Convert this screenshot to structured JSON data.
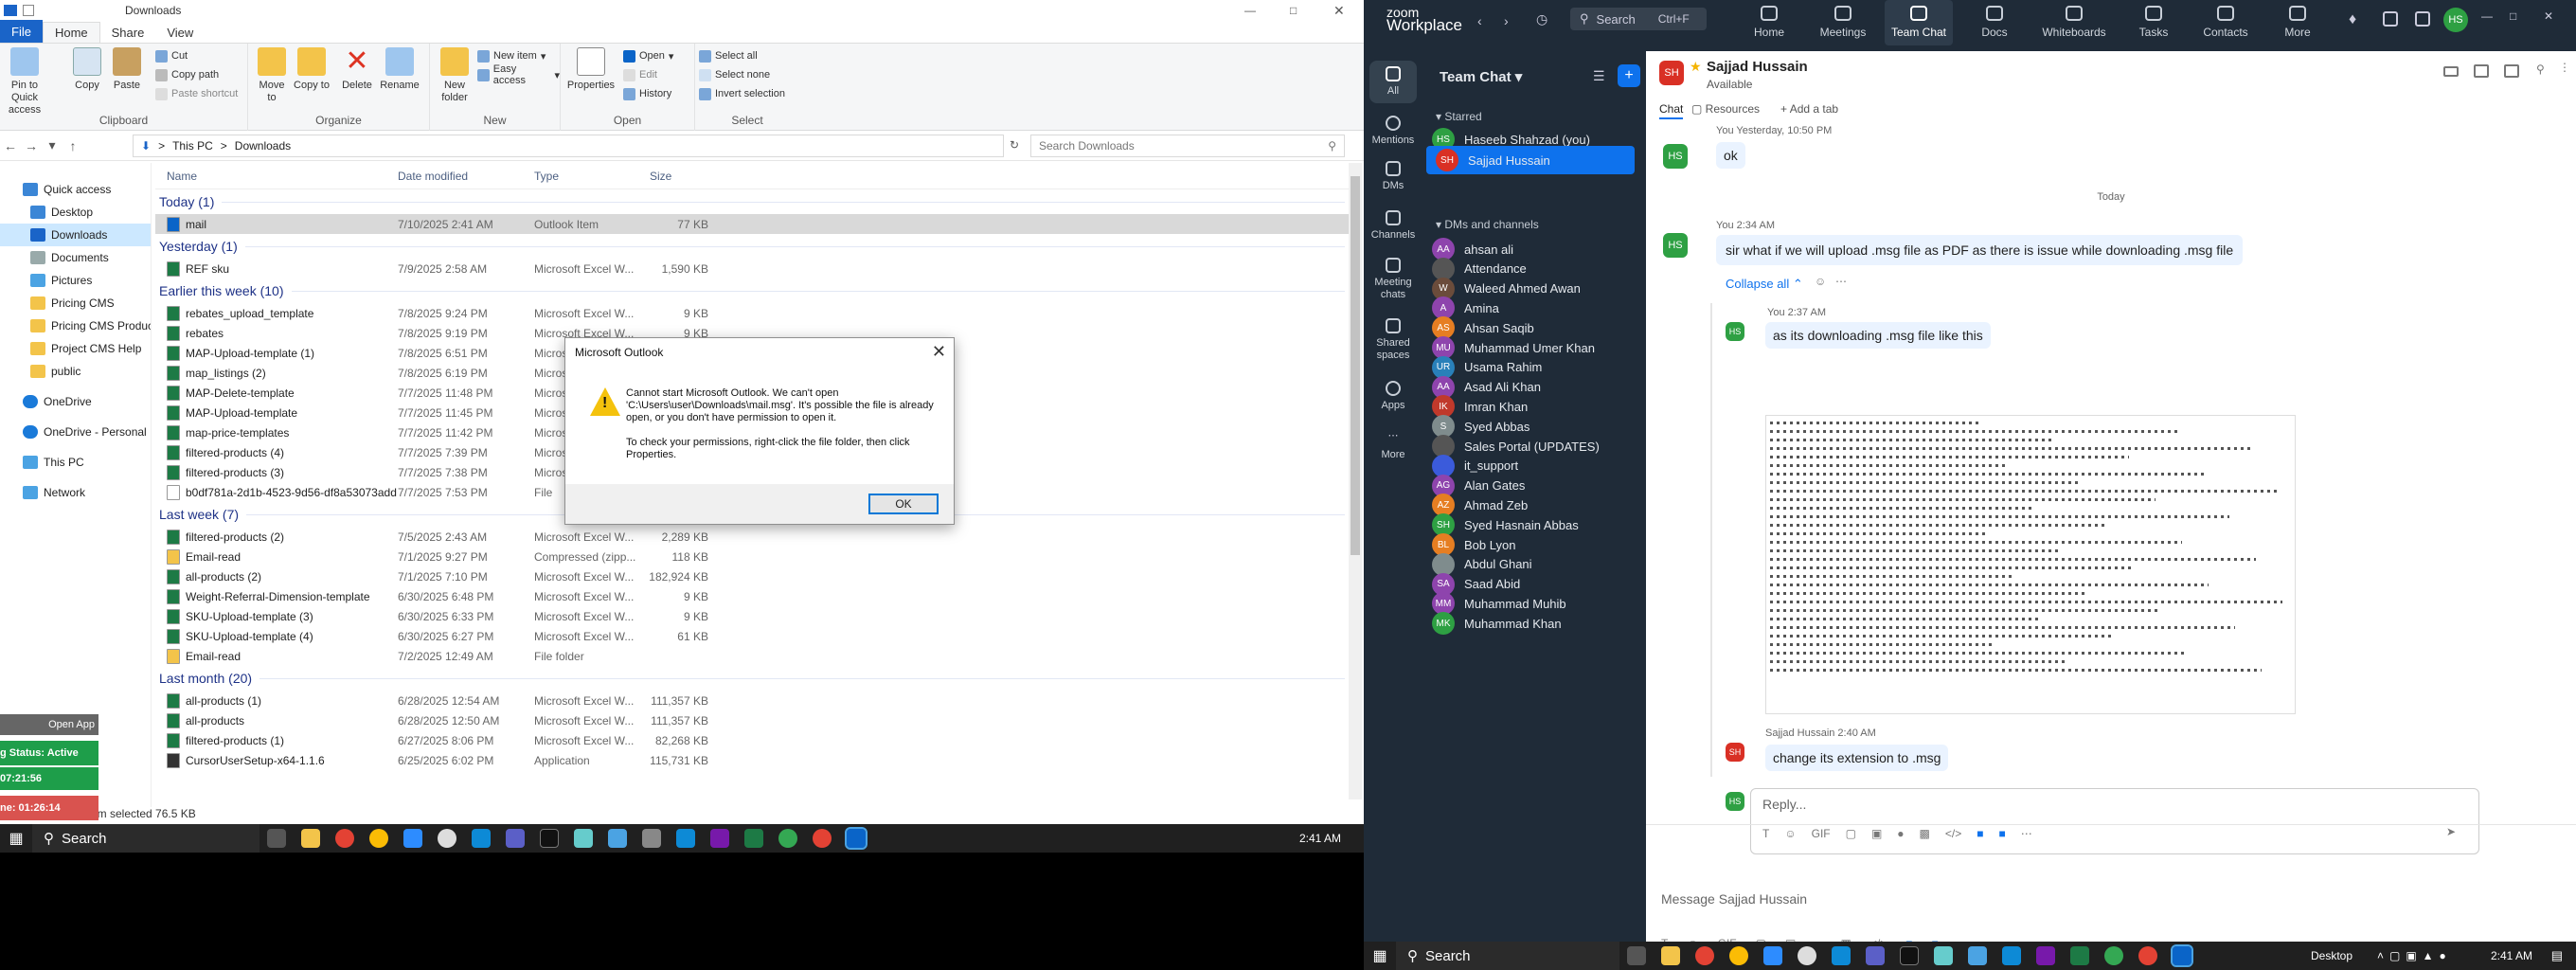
{
  "explorer": {
    "title": "Downloads",
    "tabs": [
      "File",
      "Home",
      "Share",
      "View"
    ],
    "ribbon": {
      "clipboard": {
        "label": "Clipboard",
        "pin": "Pin to Quick access",
        "copy": "Copy",
        "paste": "Paste",
        "cut": "Cut",
        "copy_path": "Copy path",
        "paste_shortcut": "Paste shortcut"
      },
      "organize": {
        "label": "Organize",
        "move_to": "Move to",
        "copy_to": "Copy to",
        "delete": "Delete",
        "rename": "Rename"
      },
      "new": {
        "label": "New",
        "new_folder": "New folder",
        "new_item": "New item",
        "easy_access": "Easy access"
      },
      "open": {
        "label": "Open",
        "properties": "Properties",
        "open": "Open",
        "edit": "Edit",
        "history": "History"
      },
      "select": {
        "label": "Select",
        "select_all": "Select all",
        "select_none": "Select none",
        "invert": "Invert selection"
      }
    },
    "breadcrumb": [
      "This PC",
      "Downloads"
    ],
    "search_placeholder": "Search Downloads",
    "nav": [
      "Quick access",
      "Desktop",
      "Downloads",
      "Documents",
      "Pictures",
      "Pricing CMS",
      "Pricing CMS Produc",
      "Project CMS Help",
      "public",
      "OneDrive",
      "OneDrive - Personal",
      "This PC",
      "Network"
    ],
    "columns": {
      "name": "Name",
      "date": "Date modified",
      "type": "Type",
      "size": "Size"
    },
    "groups": [
      {
        "label": "Today (1)",
        "files": [
          {
            "name": "mail",
            "date": "7/10/2025 2:41 AM",
            "type": "Outlook Item",
            "size": "77 KB",
            "selected": true
          }
        ]
      },
      {
        "label": "Yesterday (1)",
        "files": [
          {
            "name": "REF sku",
            "date": "7/9/2025 2:58 AM",
            "type": "Microsoft Excel W...",
            "size": "1,590 KB"
          }
        ]
      },
      {
        "label": "Earlier this week (10)",
        "files": [
          {
            "name": "rebates_upload_template",
            "date": "7/8/2025 9:24 PM",
            "type": "Microsoft Excel W...",
            "size": "9 KB"
          },
          {
            "name": "rebates",
            "date": "7/8/2025 9:19 PM",
            "type": "Microsoft Excel W...",
            "size": "9 KB"
          },
          {
            "name": "MAP-Upload-template (1)",
            "date": "7/8/2025 6:51 PM",
            "type": "Microsoft Excel W...",
            "size": "9 KB"
          },
          {
            "name": "map_listings (2)",
            "date": "7/8/2025 6:19 PM",
            "type": "Microsoft Excel W...",
            "size": ""
          },
          {
            "name": "MAP-Delete-template",
            "date": "7/7/2025 11:48 PM",
            "type": "Microsoft Excel W...",
            "size": ""
          },
          {
            "name": "MAP-Upload-template",
            "date": "7/7/2025 11:45 PM",
            "type": "Microsoft Excel W...",
            "size": ""
          },
          {
            "name": "map-price-templates",
            "date": "7/7/2025 11:42 PM",
            "type": "Microsoft Excel W...",
            "size": ""
          },
          {
            "name": "filtered-products (4)",
            "date": "7/7/2025 7:39 PM",
            "type": "Microsoft Excel W...",
            "size": ""
          },
          {
            "name": "filtered-products (3)",
            "date": "7/7/2025 7:38 PM",
            "type": "Microsoft Excel W...",
            "size": ""
          },
          {
            "name": "b0df781a-2d1b-4523-9d56-df8a53073add",
            "date": "7/7/2025 7:53 PM",
            "type": "File",
            "size": ""
          }
        ]
      },
      {
        "label": "Last week (7)",
        "files": [
          {
            "name": "filtered-products (2)",
            "date": "7/5/2025 2:43 AM",
            "type": "Microsoft Excel W...",
            "size": "2,289 KB"
          },
          {
            "name": "Email-read",
            "date": "7/1/2025 9:27 PM",
            "type": "Compressed (zipp...",
            "size": "118 KB"
          },
          {
            "name": "all-products (2)",
            "date": "7/1/2025 7:10 PM",
            "type": "Microsoft Excel W...",
            "size": "182,924 KB"
          },
          {
            "name": "Weight-Referral-Dimension-template",
            "date": "6/30/2025 6:48 PM",
            "type": "Microsoft Excel W...",
            "size": "9 KB"
          },
          {
            "name": "SKU-Upload-template (3)",
            "date": "6/30/2025 6:33 PM",
            "type": "Microsoft Excel W...",
            "size": "9 KB"
          },
          {
            "name": "SKU-Upload-template (4)",
            "date": "6/30/2025 6:27 PM",
            "type": "Microsoft Excel W...",
            "size": "61 KB"
          },
          {
            "name": "Email-read",
            "date": "7/2/2025 12:49 AM",
            "type": "File folder",
            "size": ""
          }
        ]
      },
      {
        "label": "Last month (20)",
        "files": [
          {
            "name": "all-products (1)",
            "date": "6/28/2025 12:54 AM",
            "type": "Microsoft Excel W...",
            "size": "111,357 KB"
          },
          {
            "name": "all-products",
            "date": "6/28/2025 12:50 AM",
            "type": "Microsoft Excel W...",
            "size": "111,357 KB"
          },
          {
            "name": "filtered-products (1)",
            "date": "6/27/2025 8:06 PM",
            "type": "Microsoft Excel W...",
            "size": "82,268 KB"
          },
          {
            "name": "CursorUserSetup-x64-1.1.6",
            "date": "6/25/2025 6:02 PM",
            "type": "Application",
            "size": "115,731 KB"
          }
        ]
      }
    ],
    "status": "1 item selected  76.5 KB"
  },
  "dialog": {
    "title": "Microsoft Outlook",
    "message": "Cannot start Microsoft Outlook. We can't open 'C:\\Users\\user\\Downloads\\mail.msg'. It's possible the file is already open, or you don't have permission to open it.",
    "message2": "To check your permissions, right-click the file folder, then click Properties.",
    "ok": "OK"
  },
  "widget": {
    "open_app": "Open App",
    "status": "g Status: Active",
    "time1": "07:21:56",
    "time2": "ne: 01:26:14"
  },
  "taskbar_left": {
    "search": "Search",
    "time": "2:41 AM"
  },
  "zoom": {
    "logo_top": "zoom",
    "logo_bottom": "Workplace",
    "search": "Search",
    "search_shortcut": "Ctrl+F",
    "tabs": [
      "Home",
      "Meetings",
      "Team Chat",
      "Docs",
      "Whiteboards",
      "Tasks",
      "Contacts",
      "More"
    ],
    "rail": [
      "All",
      "Mentions",
      "DMs",
      "Channels",
      "Meeting chats",
      "Shared spaces",
      "Apps",
      "More"
    ],
    "sidebar_title": "Team Chat",
    "starred_label": "Starred",
    "starred": [
      {
        "initials": "HS",
        "name": "Haseeb Shahzad (you)",
        "color": "#2ea043"
      },
      {
        "initials": "SH",
        "name": "Sajjad Hussain",
        "color": "#d93025",
        "selected": true
      }
    ],
    "dms_label": "DMs and channels",
    "dms": [
      {
        "initials": "AA",
        "name": "ahsan ali",
        "color": "#8e44ad"
      },
      {
        "initials": "",
        "name": "Attendance",
        "color": "#555555"
      },
      {
        "initials": "W",
        "name": "Waleed Ahmed Awan",
        "color": "#6b4c3b"
      },
      {
        "initials": "A",
        "name": "Amina",
        "color": "#8e44ad"
      },
      {
        "initials": "AS",
        "name": "Ahsan Saqib",
        "color": "#e67e22"
      },
      {
        "initials": "MU",
        "name": "Muhammad Umer Khan",
        "color": "#8e44ad"
      },
      {
        "initials": "UR",
        "name": "Usama Rahim",
        "color": "#2980b9"
      },
      {
        "initials": "AA",
        "name": "Asad Ali Khan",
        "color": "#8e44ad"
      },
      {
        "initials": "IK",
        "name": "Imran Khan",
        "color": "#c0392b"
      },
      {
        "initials": "S",
        "name": "Syed Abbas",
        "color": "#7f8c8d"
      },
      {
        "initials": "",
        "name": "Sales Portal (UPDATES)",
        "color": "#555555"
      },
      {
        "initials": "",
        "name": "it_support",
        "color": "#3b5bdb"
      },
      {
        "initials": "AG",
        "name": "Alan Gates",
        "color": "#8e44ad"
      },
      {
        "initials": "AZ",
        "name": "Ahmad Zeb",
        "color": "#e67e22"
      },
      {
        "initials": "SH",
        "name": "Syed Hasnain Abbas",
        "color": "#2ea043"
      },
      {
        "initials": "BL",
        "name": "Bob Lyon",
        "color": "#e67e22"
      },
      {
        "initials": "",
        "name": "Abdul Ghani",
        "color": "#7f8c8d"
      },
      {
        "initials": "SA",
        "name": "Saad Abid",
        "color": "#8e44ad"
      },
      {
        "initials": "MM",
        "name": "Muhammad Muhib",
        "color": "#8e44ad"
      },
      {
        "initials": "MK",
        "name": "Muhammad Khan",
        "color": "#2ea043"
      }
    ],
    "chat": {
      "name": "Sajjad Hussain",
      "status": "Available",
      "tabs": [
        "Chat",
        "Resources",
        "Add a tab"
      ],
      "meta1": "You Yesterday, 10:50 PM",
      "msg1": "ok",
      "today": "Today",
      "meta2": "You 2:34 AM",
      "msg2": "sir what if we will upload .msg file as PDF as there is issue while downloading .msg file",
      "collapse": "Collapse all",
      "meta3": "You 2:37 AM",
      "msg3": "as its downloading .msg file like this",
      "meta4": "Sajjad Hussain 2:40 AM",
      "msg4": "change its extension to .msg",
      "reply_placeholder": "Reply...",
      "composer_placeholder": "Message Sajjad Hussain"
    }
  },
  "taskbar_right": {
    "search": "Search",
    "desktop": "Desktop",
    "time": "2:41 AM"
  }
}
